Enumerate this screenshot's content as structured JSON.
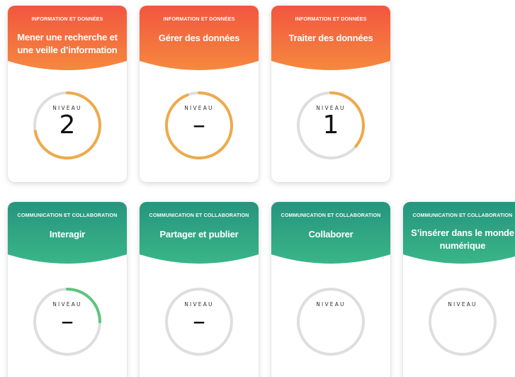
{
  "colors": {
    "info_gradient_top": "#f2563f",
    "info_gradient_bottom": "#f6883f",
    "comm_gradient_top": "#26957f",
    "comm_gradient_bottom": "#3ab587",
    "ring_track": "#dedede",
    "ring_info_progress": "#eeaa4a",
    "ring_comm_progress": "#5cc57f"
  },
  "cards": [
    {
      "category": "INFORMATION ET DONNÉES",
      "title": "Mener une recherche et une veille d’information",
      "level_label": "NIVEAU",
      "level_value": "2",
      "progress": 0.72,
      "theme": "info"
    },
    {
      "category": "INFORMATION ET DONNÉES",
      "title": "Gérer des données",
      "level_label": "NIVEAU",
      "level_value": "–",
      "progress": 0.94,
      "theme": "info"
    },
    {
      "category": "INFORMATION ET DONNÉES",
      "title": "Traiter des données",
      "level_label": "NIVEAU",
      "level_value": "1",
      "progress": 0.36,
      "theme": "info"
    },
    {
      "category": "COMMUNICATION ET COLLABORATION",
      "title": "Interagir",
      "level_label": "NIVEAU",
      "level_value": "–",
      "progress": 0.25,
      "theme": "comm"
    },
    {
      "category": "COMMUNICATION ET COLLABORATION",
      "title": "Partager et publier",
      "level_label": "NIVEAU",
      "level_value": "–",
      "progress": 0,
      "theme": "comm"
    },
    {
      "category": "COMMUNICATION ET COLLABORATION",
      "title": "Collaborer",
      "level_label": "NIVEAU",
      "level_value": "",
      "progress": 0,
      "theme": "comm"
    },
    {
      "category": "COMMUNICATION ET COLLABORATION",
      "title": "S’insérer dans le monde numérique",
      "level_label": "NIVEAU",
      "level_value": "",
      "progress": 0,
      "theme": "comm"
    }
  ]
}
